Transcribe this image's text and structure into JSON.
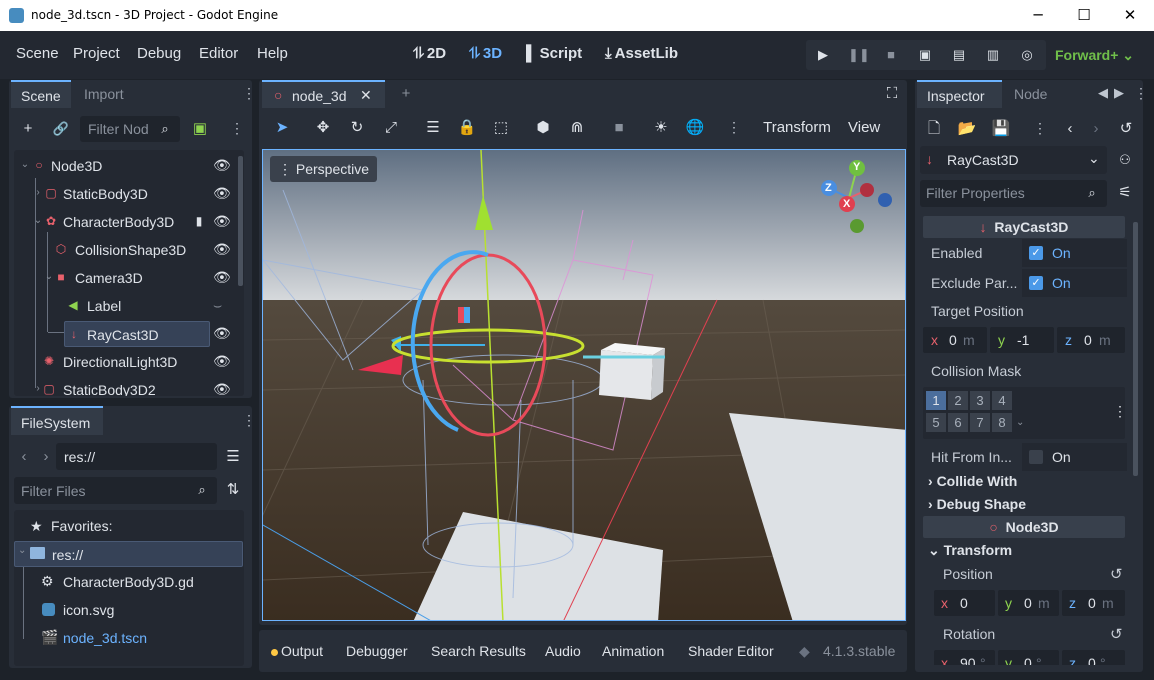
{
  "window": {
    "title": "node_3d.tscn - 3D Project - Godot Engine",
    "minimize": "─",
    "maximize": "☐",
    "close": "✕"
  },
  "menu": [
    "Scene",
    "Project",
    "Debug",
    "Editor",
    "Help"
  ],
  "workspaces": [
    {
      "icon": "⥮",
      "label": "2D"
    },
    {
      "icon": "⥮",
      "label": "3D"
    },
    {
      "icon": "▌",
      "label": "Script"
    },
    {
      "icon": "⤓",
      "label": "AssetLib"
    }
  ],
  "renderer": "Forward+",
  "scene_dock": {
    "tabs": [
      "Scene",
      "Import"
    ],
    "filter_placeholder": "Filter Nod",
    "nodes": [
      {
        "label": "Node3D",
        "icon": "○",
        "color": "#e8616c"
      },
      {
        "label": "StaticBody3D",
        "icon": "▢",
        "color": "#e8616c"
      },
      {
        "label": "CharacterBody3D",
        "icon": "✿",
        "color": "#e8616c"
      },
      {
        "label": "CollisionShape3D",
        "icon": "⬡",
        "color": "#e8616c"
      },
      {
        "label": "Camera3D",
        "icon": "■",
        "color": "#e8616c"
      },
      {
        "label": "Label",
        "icon": "◀",
        "color": "#8ed34f"
      },
      {
        "label": "RayCast3D",
        "icon": "↓",
        "color": "#e8616c"
      },
      {
        "label": "DirectionalLight3D",
        "icon": "✺",
        "color": "#e8616c"
      },
      {
        "label": "StaticBody3D2",
        "icon": "▢",
        "color": "#e8616c"
      }
    ]
  },
  "filesystem": {
    "tab": "FileSystem",
    "path": "res://",
    "filter_placeholder": "Filter Files",
    "favorites": "Favorites:",
    "items": [
      {
        "label": "res://"
      },
      {
        "label": "CharacterBody3D.gd"
      },
      {
        "label": "icon.svg"
      },
      {
        "label": "node_3d.tscn"
      }
    ]
  },
  "editor": {
    "tab": "node_3d",
    "add_tab": "+",
    "toolbar_transform": "Transform",
    "toolbar_view": "View",
    "viewport_label": "Perspective",
    "gizmo": {
      "y": "Y",
      "z": "Z",
      "x": "X"
    }
  },
  "bottom_panel": {
    "tabs": [
      "Output",
      "Debugger",
      "Search Results",
      "Audio",
      "Animation",
      "Shader Editor"
    ],
    "version": "4.1.3.stable"
  },
  "inspector": {
    "tabs": [
      "Inspector",
      "Node"
    ],
    "node_selector": "RayCast3D",
    "filter_placeholder": "Filter Properties",
    "raycast_section": "RayCast3D",
    "enabled_label": "Enabled",
    "enabled_value": "On",
    "exclude_label": "Exclude Par...",
    "exclude_value": "On",
    "target_label": "Target Position",
    "target": {
      "x_label": "x",
      "x": "0",
      "x_unit": "m",
      "y_label": "y",
      "y": "-1",
      "z_label": "z",
      "z": "0",
      "z_unit": "m"
    },
    "mask_label": "Collision Mask",
    "mask_cells": [
      "1",
      "2",
      "3",
      "4",
      "5",
      "6",
      "7",
      "8"
    ],
    "hit_from_label": "Hit From In...",
    "hit_from_value": "On",
    "collide_with": "Collide With",
    "debug_shape": "Debug Shape",
    "node3d_section": "Node3D",
    "transform": "Transform",
    "position_label": "Position",
    "position": {
      "x_label": "x",
      "x": "0",
      "y_label": "y",
      "y": "0",
      "y_unit": "m",
      "z_label": "z",
      "z": "0",
      "z_unit": "m"
    },
    "rotation_label": "Rotation",
    "rotation": {
      "x_label": "x",
      "x": "90",
      "x_unit": "°",
      "y_label": "y",
      "y": "0",
      "y_unit": "°",
      "z_label": "z",
      "z": "0",
      "z_unit": "°"
    }
  }
}
